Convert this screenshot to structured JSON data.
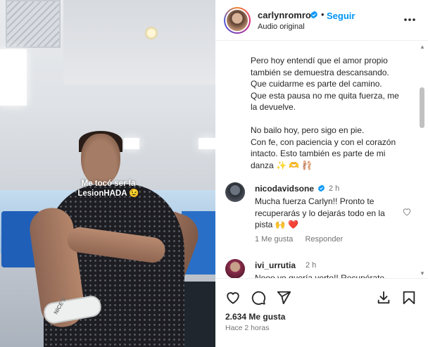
{
  "post": {
    "overlay_text": "Me tocó ser la LesionHADA 😉",
    "wristband_text": "NICE'S"
  },
  "header": {
    "username": "carlynromro",
    "separator": "•",
    "follow_label": "Seguir",
    "audio_label": "Audio original"
  },
  "caption": {
    "lines_1": [
      "Pero hoy entendí que el amor propio",
      "también se demuestra descansando.",
      "Que cuidarme es parte del camino.",
      "Que esta pausa no me quita fuerza, me",
      "la devuelve."
    ],
    "lines_2": [
      "No bailo hoy, pero sigo en pie.",
      "Con fe, con paciencia y con el corazón",
      "intacto. Esto también es parte de mi",
      "danza ✨ 🫶 🩰"
    ]
  },
  "comments": [
    {
      "username": "nicodavidsone",
      "time": "2 h",
      "lines": [
        "Mucha fuerza Carlyn!! Pronto te",
        "recuperarás y lo dejarás todo en la",
        "pista 🙌 ❤️"
      ],
      "likes_label": "1 Me gusta",
      "reply_label": "Responder"
    },
    {
      "username": "ivi_urrutia",
      "time": "2 h",
      "lines": [
        "Nooo yo quería verte!! Recupérate"
      ]
    }
  ],
  "footer": {
    "likes": "2.634 Me gusta",
    "time_ago": "Hace 2 horas"
  },
  "colors": {
    "link_blue": "#0095f6",
    "verified_blue": "#0095f6",
    "heart_red": "#ff3040"
  },
  "icons": [
    "verified-icon",
    "more-icon",
    "heart-icon",
    "comment-icon",
    "share-icon",
    "save-icon",
    "download-icon"
  ]
}
